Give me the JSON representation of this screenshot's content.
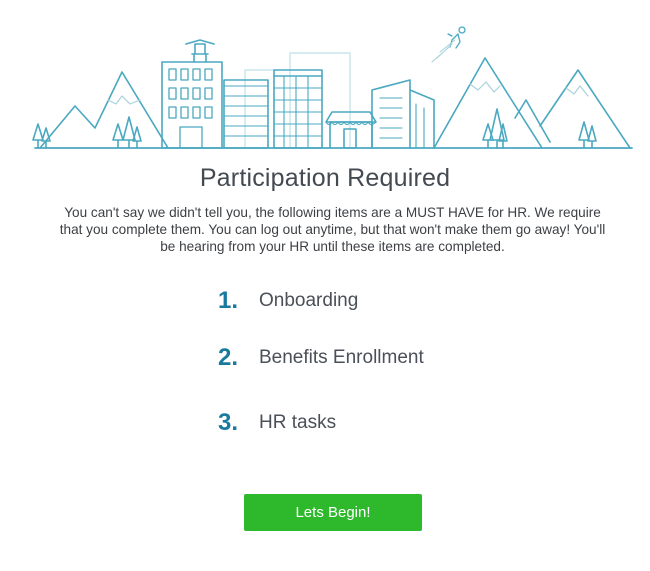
{
  "header": {
    "illustration_icon": "city-skyline-illustration",
    "accent_color": "#4aa8c0"
  },
  "main": {
    "title": "Participation Required",
    "intro": "You can't say we didn't tell you, the following items are a MUST HAVE for HR. We require that you complete them. You can log out anytime, but that won't make them go away! You'll be hearing from your HR until these items are completed.",
    "steps": [
      {
        "number": "1.",
        "label": "Onboarding"
      },
      {
        "number": "2.",
        "label": "Benefits Enrollment"
      },
      {
        "number": "3.",
        "label": "HR tasks"
      }
    ],
    "begin_button": {
      "label": "Lets Begin!",
      "color": "#2db92b"
    },
    "number_color": "#1a7a9e"
  }
}
